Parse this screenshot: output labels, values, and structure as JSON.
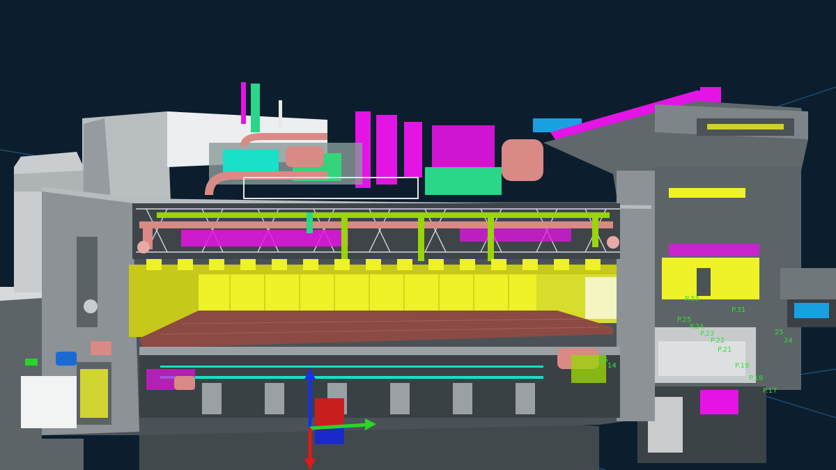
{
  "viewer": {
    "background": "#0c1e2e",
    "view_mode": "3D section cut",
    "colors": {
      "structure": "#8c9296",
      "structure_dark": "#4b5257",
      "hvac_duct": "#eef226",
      "piping_salmon": "#d98a84",
      "piping_green": "#9ad40b",
      "electrical_magenta": "#e414e4",
      "fire_cyan": "#19e0c8",
      "cable_tray": "#ffffff",
      "annotation": "#33e033"
    },
    "axis_gizmo": {
      "x_color": "#2ad42a",
      "y_color": "#e01818",
      "z_color": "#1830e6",
      "cube_colors": [
        "#c81e1e",
        "#1a2ac8"
      ]
    }
  },
  "annotations": {
    "labels": [
      {
        "text": "P.33",
        "id": "p33"
      },
      {
        "text": "P.31",
        "id": "p31"
      },
      {
        "text": "P.25",
        "id": "p25"
      },
      {
        "text": "P.24",
        "id": "p24"
      },
      {
        "text": "P.23",
        "id": "p23"
      },
      {
        "text": "P.22",
        "id": "p22"
      },
      {
        "text": "P.21",
        "id": "p21"
      },
      {
        "text": "P.19",
        "id": "p19"
      },
      {
        "text": "P.18",
        "id": "p18"
      },
      {
        "text": "P.17",
        "id": "p17"
      },
      {
        "text": "14",
        "id": "n14"
      },
      {
        "text": "15",
        "id": "n15"
      },
      {
        "text": "25",
        "id": "n25"
      },
      {
        "text": "24",
        "id": "n24"
      }
    ]
  }
}
